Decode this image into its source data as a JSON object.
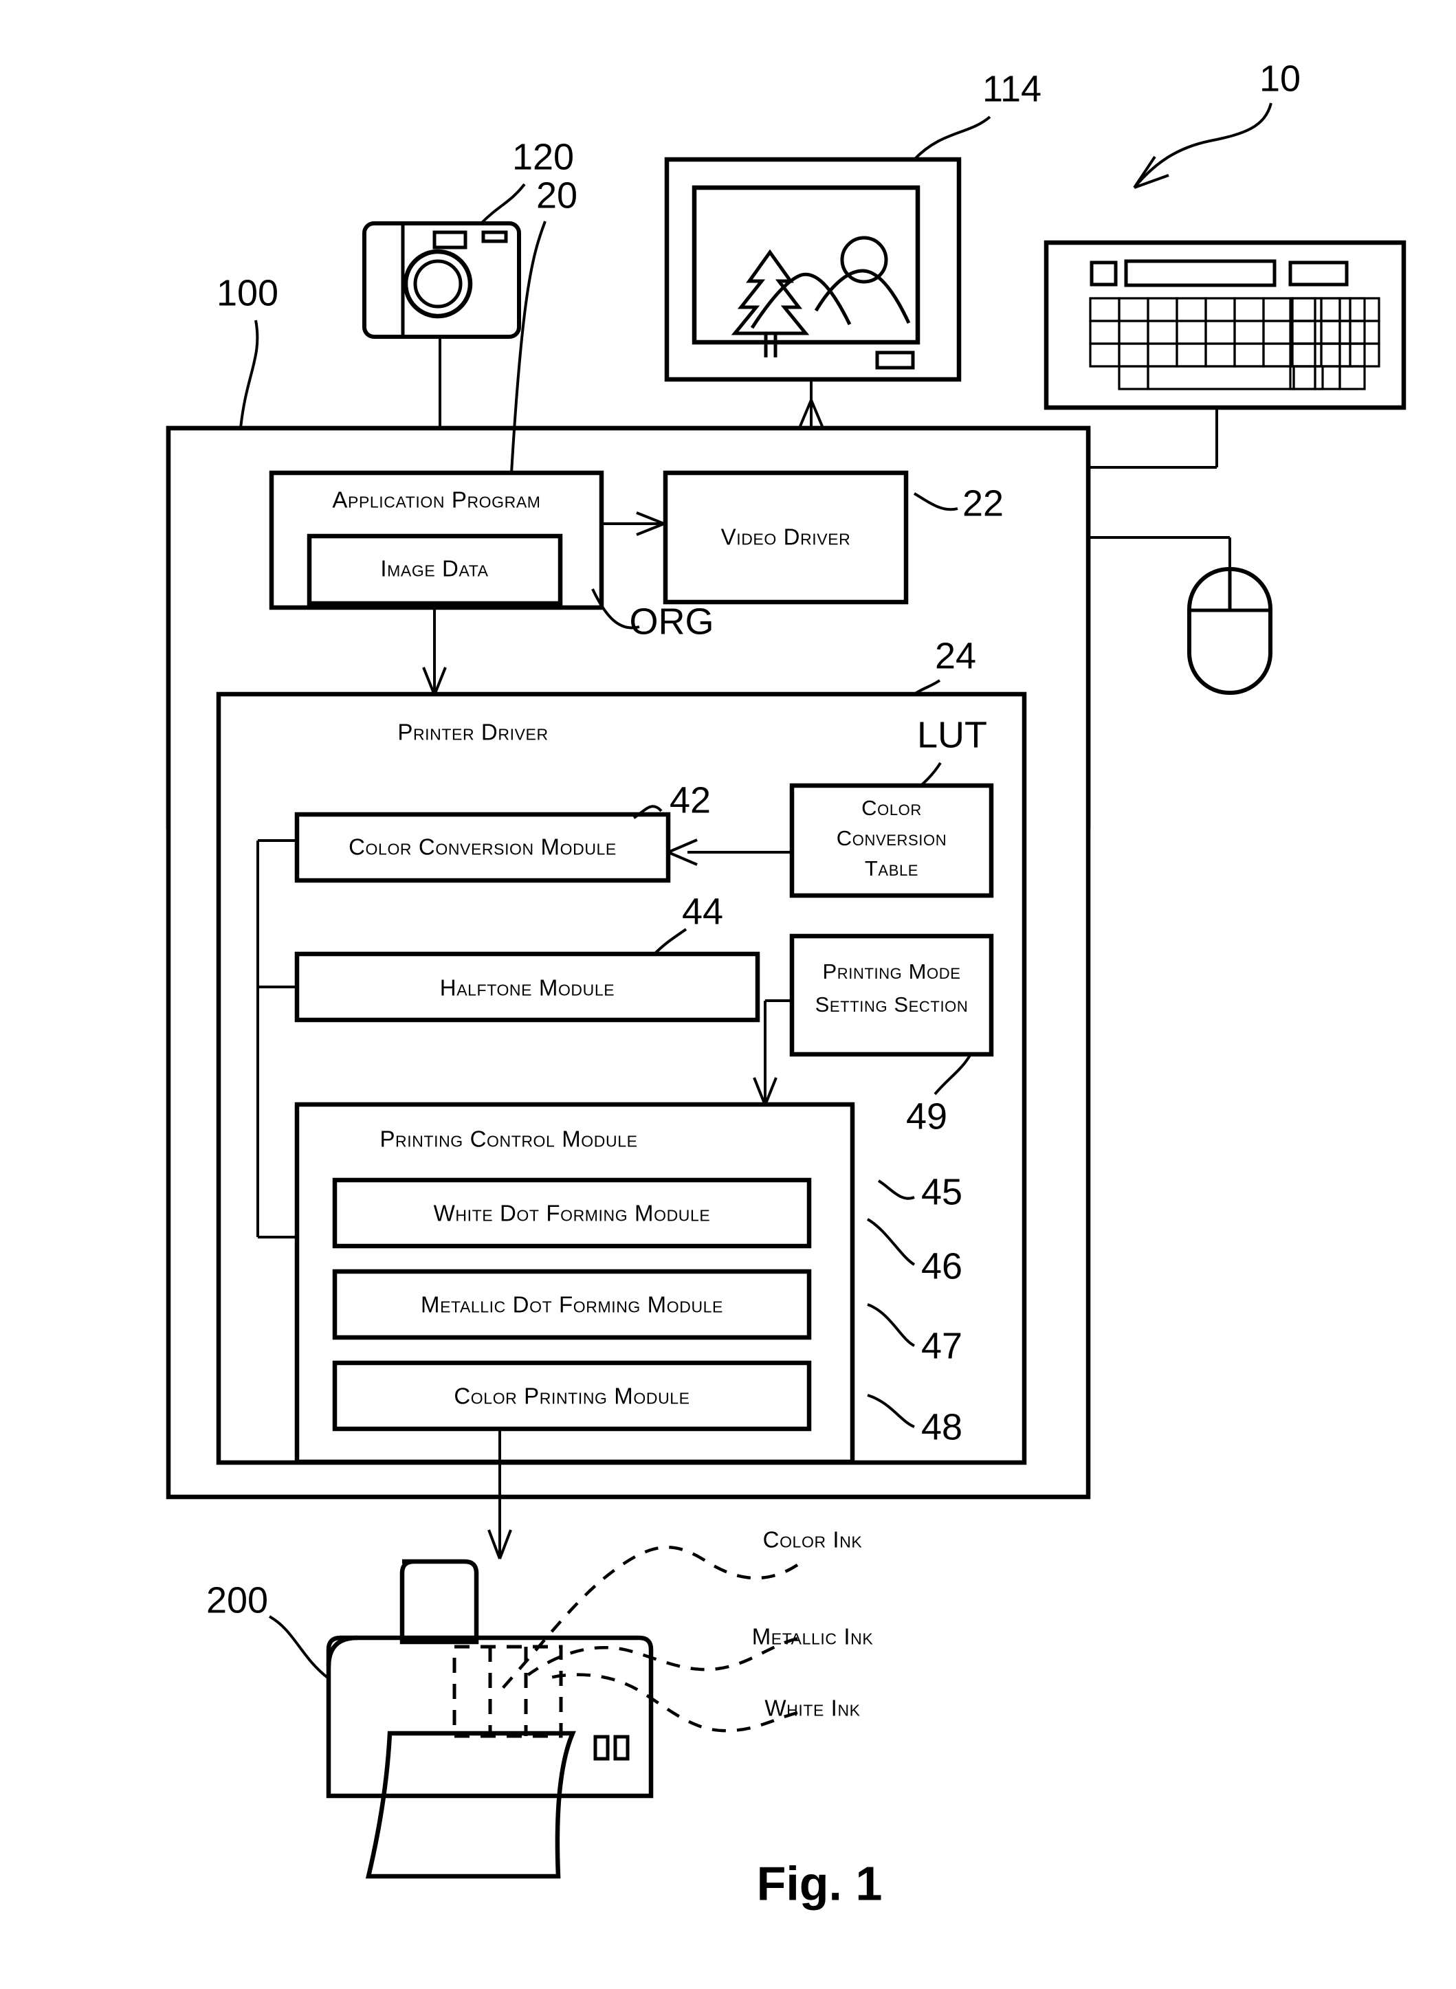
{
  "figure": {
    "caption": "Fig. 1",
    "system_ref": "10"
  },
  "refs": {
    "computer": "100",
    "application_program": "20",
    "video_driver": "22",
    "printer_driver": "24",
    "color_conversion_module": "42",
    "halftone_module": "44",
    "printing_control_module": "45",
    "white_dot_forming_module": "46",
    "metallic_dot_forming_module": "47",
    "color_printing_module": "48",
    "printing_mode_setting_section": "49",
    "monitor": "114",
    "camera": "120",
    "printer": "200",
    "lut": "LUT",
    "org": "ORG"
  },
  "computer": {
    "application_program": {
      "label": "Application Program",
      "image_data_label": "Image Data"
    },
    "video_driver": {
      "label": "Video Driver"
    },
    "printer_driver": {
      "label": "Printer Driver",
      "color_conversion_module": "Color Conversion Module",
      "color_conversion_table": [
        "Color",
        "Conversion",
        "Table"
      ],
      "halftone_module": "Halftone Module",
      "printing_mode_setting_section": [
        "Printing Mode",
        "Setting Section"
      ],
      "printing_control_module": {
        "label": "Printing Control Module",
        "submodules": [
          "White Dot Forming Module",
          "Metallic Dot Forming Module",
          "Color Printing Module"
        ]
      }
    }
  },
  "printer": {
    "ink_labels": [
      "Color Ink",
      "Metallic Ink",
      "White Ink"
    ]
  },
  "peripherals": {
    "camera": "digital-camera",
    "monitor": "crt-monitor",
    "keyboard": "keyboard",
    "mouse": "mouse"
  },
  "colors": {
    "stroke": "#000000",
    "background": "#ffffff"
  }
}
